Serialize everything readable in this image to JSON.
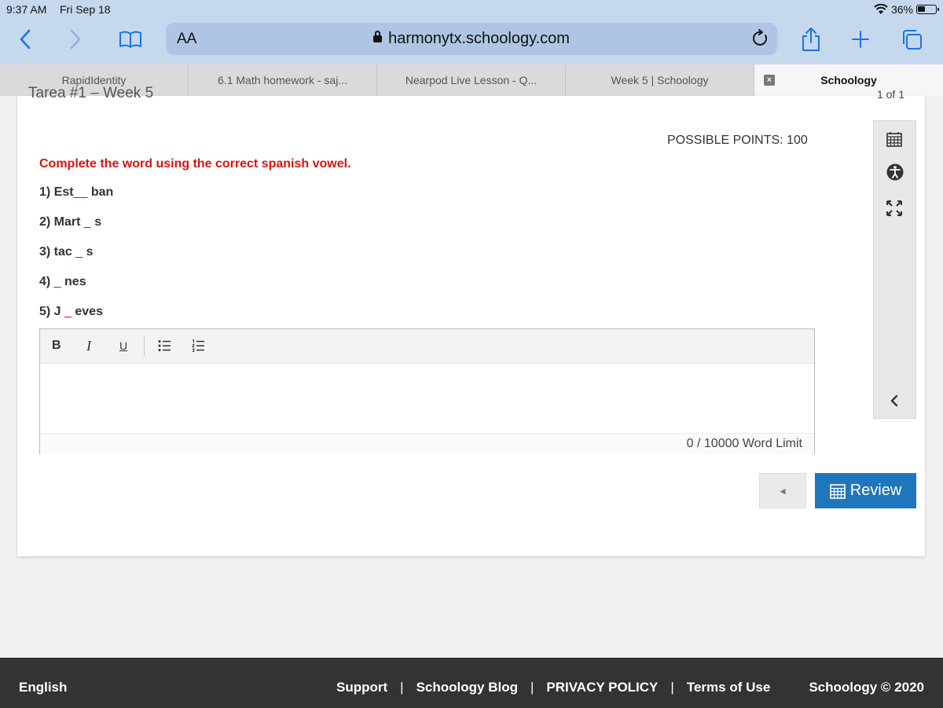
{
  "status_bar": {
    "time": "9:37 AM",
    "date": "Fri Sep 18",
    "battery": "36%"
  },
  "browser": {
    "text_size_label": "AA",
    "url": "harmonytx.schoology.com",
    "accent_color": "#1a73e8",
    "tabs": [
      {
        "label": "RapidIdentity"
      },
      {
        "label": "6.1 Math homework - saj..."
      },
      {
        "label": "Nearpod Live Lesson - Q..."
      },
      {
        "label": "Week 5 | Schoology"
      },
      {
        "label": "Schoology",
        "active": true,
        "close_label": "×"
      }
    ]
  },
  "assignment": {
    "title_partial": "Tarea #1 – Week 5",
    "page_count": "1 of 1",
    "points": "POSSIBLE POINTS: 100",
    "instruction": "Complete the word using the correct spanish vowel.",
    "instruction_color": "#e01010",
    "questions": [
      {
        "num": "1) ",
        "before": "Est",
        "blank": "__",
        "after": " ban"
      },
      {
        "num": "2) ",
        "before": "Mart ",
        "blank": "_",
        "after": " s"
      },
      {
        "num": "3) ",
        "before": "tac ",
        "blank": "_",
        "after": " s"
      },
      {
        "num": "4) ",
        "before": "",
        "blank": "_",
        "after": " nes"
      },
      {
        "num": "5) ",
        "before": "J ",
        "blank": "_",
        "after": " eves"
      }
    ]
  },
  "editor": {
    "toolbar": {
      "bold": "B",
      "italic": "I",
      "underline": "U"
    },
    "word_limit": "0 / 10000 Word Limit"
  },
  "side_panel": {
    "icons": [
      "calendar-icon",
      "accessibility-icon",
      "expand-icon",
      "collapse-chevron-icon"
    ]
  },
  "navigation": {
    "prev_label": "◄",
    "review_label": "Review",
    "review_color": "#1e76bd"
  },
  "footer": {
    "language": "English",
    "links": [
      "Support",
      "Schoology Blog",
      "PRIVACY POLICY",
      "Terms of Use"
    ],
    "separator": "|",
    "copyright": "Schoology © 2020"
  }
}
